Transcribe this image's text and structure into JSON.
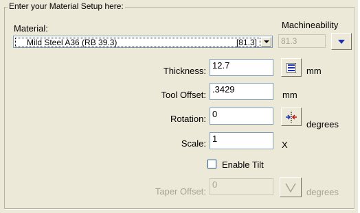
{
  "group": {
    "title": "Enter your Material Setup here:"
  },
  "material": {
    "label": "Material:",
    "selected_name": "Mild Steel A36 (RB 39.3)",
    "selected_code": "[81.3]"
  },
  "machineability": {
    "label": "Machineability",
    "value": "81.3"
  },
  "thickness": {
    "label": "Thickness:",
    "value": "12.7",
    "unit": "mm"
  },
  "tool_offset": {
    "label": "Tool Offset:",
    "value": ".3429",
    "unit": "mm"
  },
  "rotation": {
    "label": "Rotation:",
    "value": "0",
    "unit": "degrees"
  },
  "scale": {
    "label": "Scale:",
    "value": "1",
    "unit": "X"
  },
  "enable_tilt": {
    "label": "Enable Tilt",
    "checked": false
  },
  "taper_offset": {
    "label": "Taper Offset:",
    "value": "0",
    "unit": "degrees"
  },
  "colors": {
    "panel_bg": "#ece9d8",
    "field_border": "#7f9db9",
    "accent_blue": "#1b2fb0",
    "disabled_text": "#a7a497"
  },
  "icons": [
    "chevron-down-icon",
    "blue-triangle-down-icon",
    "list-lines-icon",
    "flip-arrows-icon",
    "taper-v-icon"
  ]
}
